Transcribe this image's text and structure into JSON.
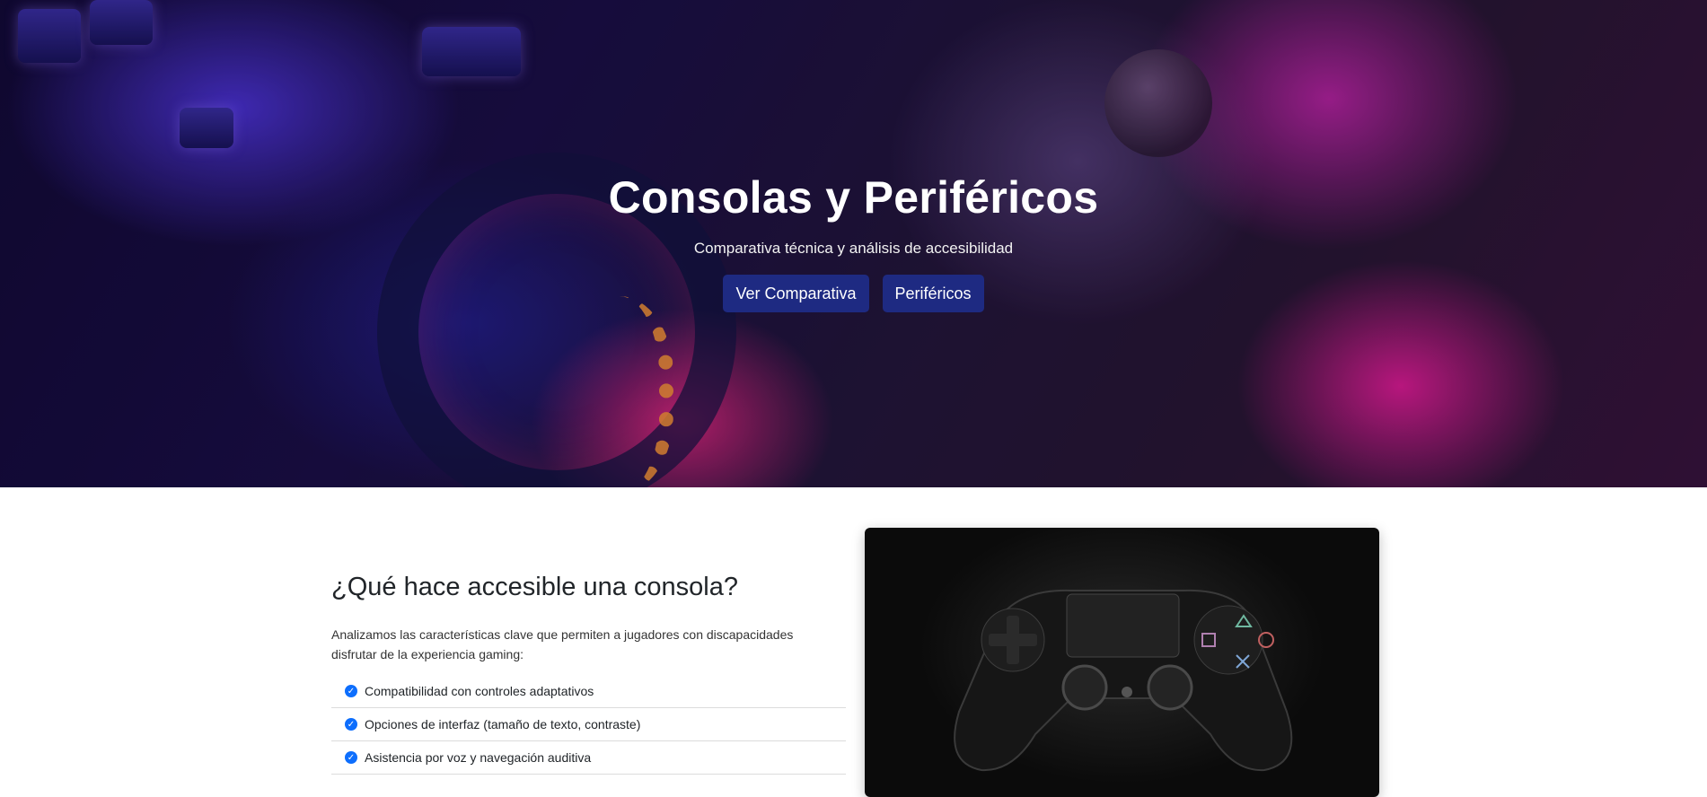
{
  "hero": {
    "title": "Consolas y Periféricos",
    "subtitle": "Comparativa técnica y análisis de accesibilidad",
    "buttons": [
      "Ver Comparativa",
      "Periféricos"
    ]
  },
  "accessibility": {
    "title": "¿Qué hace accesible una consola?",
    "text": "Analizamos las características clave que permiten a jugadores con discapacidades disfrutar de la experiencia gaming:",
    "features": [
      "Compatibilidad con controles adaptativos",
      "Opciones de interfaz (tamaño de texto, contraste)",
      "Asistencia por voz y navegación auditiva"
    ]
  },
  "colors": {
    "button": "#1e2a82",
    "check": "#0d6efd"
  },
  "icons": {
    "check": "check-circle-icon"
  }
}
